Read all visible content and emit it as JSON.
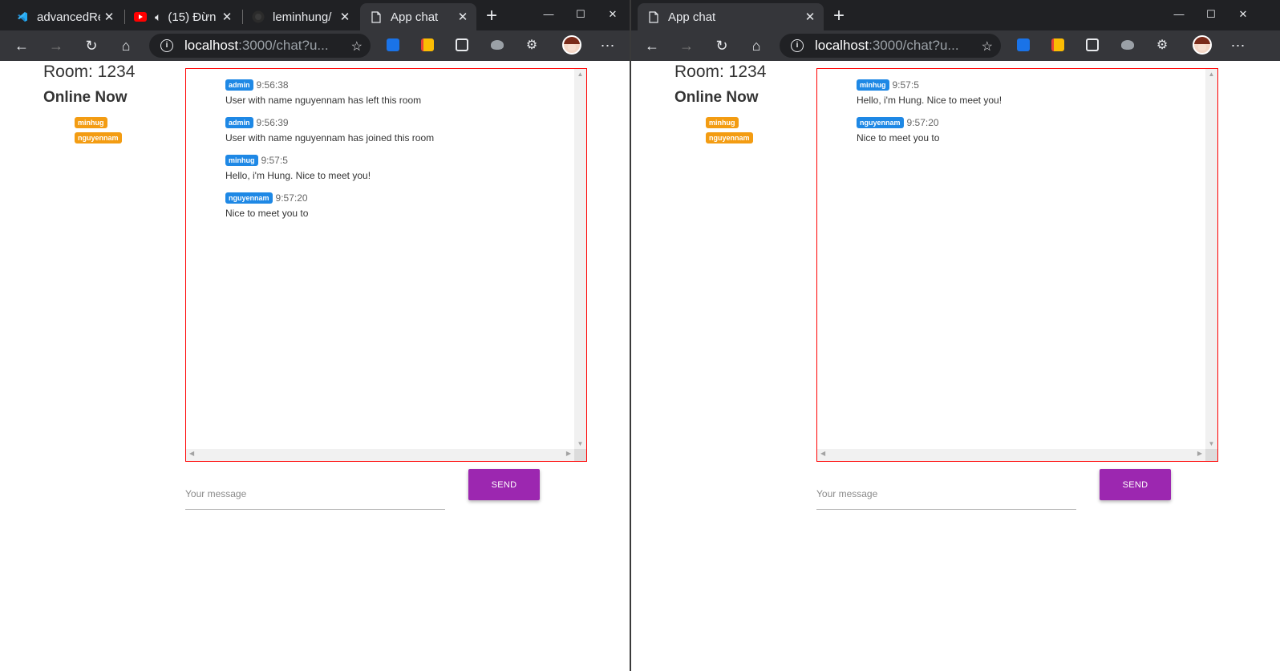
{
  "left_window": {
    "tabs": [
      {
        "title": "advancedRe",
        "icon": "vscode-icon"
      },
      {
        "title": "(15) Đừn",
        "icon": "youtube-icon"
      },
      {
        "title": "leminhung/",
        "icon": "github-icon"
      },
      {
        "title": "App chat",
        "icon": "page-icon"
      }
    ],
    "url_host": "localhost",
    "url_path": ":3000/chat?u...",
    "room_title": "Room: 1234",
    "online_title": "Online Now",
    "online_users": [
      "minhug",
      "nguyennam"
    ],
    "messages": [
      {
        "sender": "admin",
        "time": "9:56:38",
        "text": "User with name nguyennam has left this room"
      },
      {
        "sender": "admin",
        "time": "9:56:39",
        "text": "User with name nguyennam has joined this room"
      },
      {
        "sender": "minhug",
        "time": "9:57:5",
        "text": "Hello, i'm Hung. Nice to meet you!"
      },
      {
        "sender": "nguyennam",
        "time": "9:57:20",
        "text": "Nice to meet you to"
      }
    ],
    "input_placeholder": "Your message",
    "send_label": "SEND"
  },
  "right_window": {
    "tabs": [
      {
        "title": "App chat",
        "icon": "page-icon"
      }
    ],
    "url_host": "localhost",
    "url_path": ":3000/chat?u...",
    "room_title": "Room: 1234",
    "online_title": "Online Now",
    "online_users": [
      "minhug",
      "nguyennam"
    ],
    "messages": [
      {
        "sender": "minhug",
        "time": "9:57:5",
        "text": "Hello, i'm Hung. Nice to meet you!"
      },
      {
        "sender": "nguyennam",
        "time": "9:57:20",
        "text": "Nice to meet you to"
      }
    ],
    "input_placeholder": "Your message",
    "send_label": "SEND"
  },
  "colors": {
    "chat_border": "#ff0000",
    "send_button": "#9c27b0",
    "sender_badge": "#1e88e5",
    "user_badge": "#f39c12",
    "browser_chrome": "#35363a"
  }
}
